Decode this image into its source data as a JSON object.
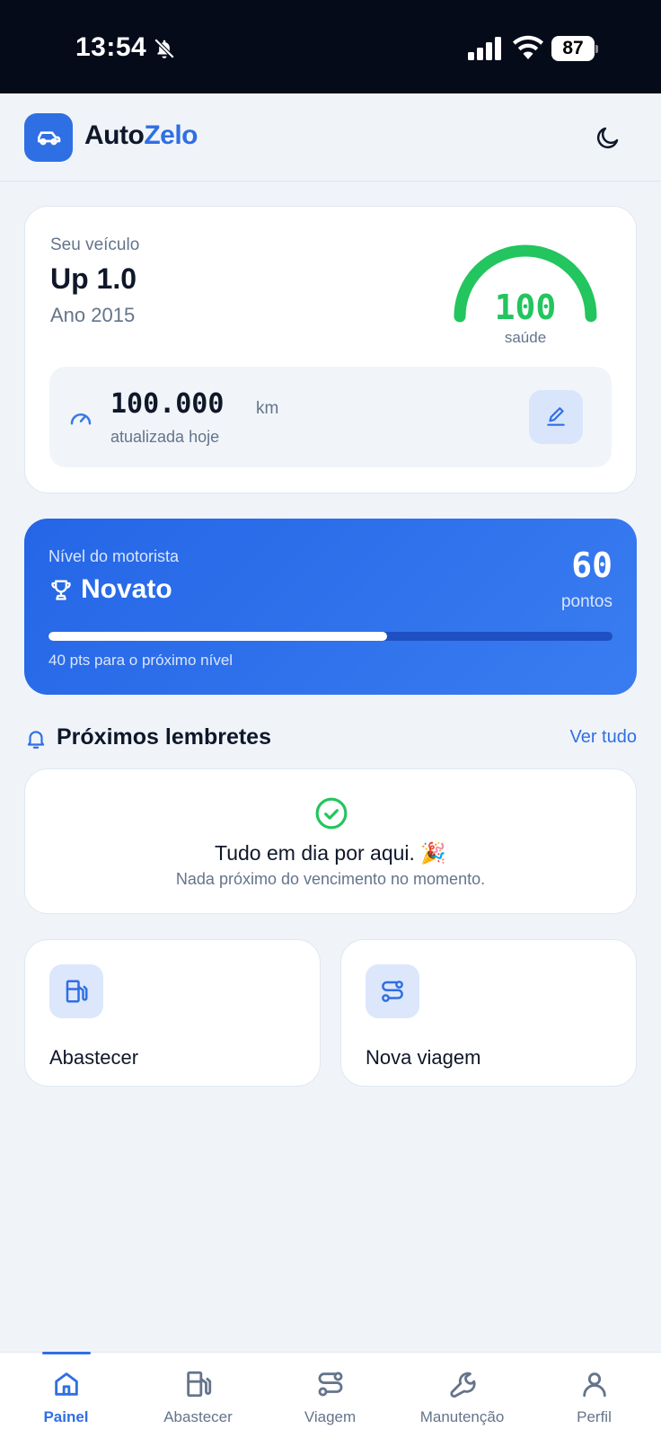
{
  "status_bar": {
    "time": "13:54",
    "battery": "87"
  },
  "header": {
    "logo_part1": "Auto",
    "logo_part2": "Zelo"
  },
  "vehicle": {
    "label": "Seu veículo",
    "name": "Up 1.0",
    "year": "Ano 2015",
    "health_value": "100",
    "health_label": "saúde",
    "health_fraction": 1.0,
    "odometer_value": "100.000",
    "odometer_unit": "km",
    "odometer_updated": "atualizada hoje"
  },
  "level": {
    "label": "Nível do motorista",
    "name": "Novato",
    "points": "60",
    "points_label": "pontos",
    "progress_fraction": 0.6,
    "next_text": "40 pts para o próximo nível"
  },
  "reminders": {
    "title": "Próximos lembretes",
    "see_all": "Ver tudo",
    "empty_title": "Tudo em dia por aqui. 🎉",
    "empty_sub": "Nada próximo do vencimento no momento."
  },
  "actions": {
    "fuel_label": "Abastecer",
    "trip_label": "Nova viagem"
  },
  "nav": {
    "items": [
      {
        "label": "Painel",
        "icon": "home-icon"
      },
      {
        "label": "Abastecer",
        "icon": "fuel-icon"
      },
      {
        "label": "Viagem",
        "icon": "route-icon"
      },
      {
        "label": "Manutenção",
        "icon": "wrench-icon"
      },
      {
        "label": "Perfil",
        "icon": "user-icon"
      }
    ],
    "active_index": 0
  },
  "colors": {
    "accent": "#2f6fe4",
    "health": "#22c55e",
    "level_bg": "#2466e6"
  }
}
